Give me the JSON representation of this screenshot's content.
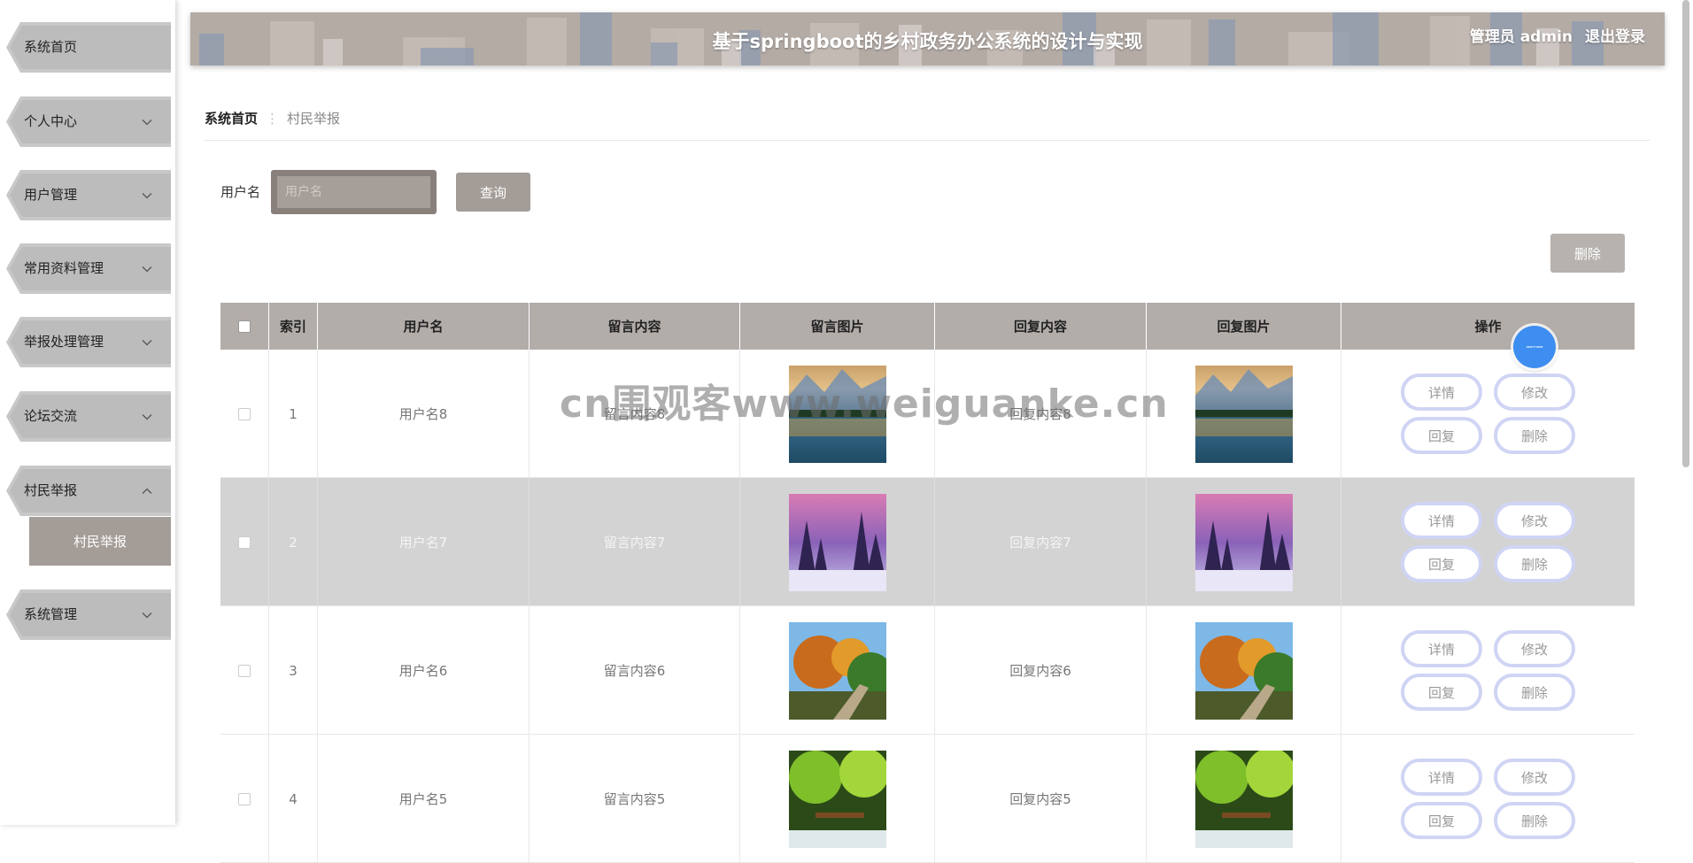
{
  "header": {
    "title": "基于springboot的乡村政务办公系统的设计与实现",
    "user_label": "管理员 admin",
    "logout_label": "退出登录"
  },
  "sidebar": {
    "items": [
      {
        "label": "系统首页"
      },
      {
        "label": "个人中心"
      },
      {
        "label": "用户管理"
      },
      {
        "label": "常用资料管理"
      },
      {
        "label": "举报处理管理"
      },
      {
        "label": "论坛交流"
      },
      {
        "label": "村民举报"
      },
      {
        "label": "系统管理"
      }
    ],
    "submenu_label": "村民举报"
  },
  "breadcrumb": {
    "home": "系统首页",
    "separator": "⋮",
    "current": "村民举报"
  },
  "search": {
    "label": "用户名",
    "placeholder": "用户名",
    "query_button": "查询"
  },
  "delete_button": "删除",
  "table": {
    "headers": [
      "索引",
      "用户名",
      "留言内容",
      "留言图片",
      "回复内容",
      "回复图片",
      "操作"
    ],
    "rows": [
      {
        "index": "1",
        "username": "用户名8",
        "message": "留言内容8",
        "reply": "回复内容8",
        "image": "lake-mountain"
      },
      {
        "index": "2",
        "username": "用户名7",
        "message": "留言内容7",
        "reply": "回复内容7",
        "image": "snow-forest"
      },
      {
        "index": "3",
        "username": "用户名6",
        "message": "留言内容6",
        "reply": "回复内容6",
        "image": "autumn-stairs"
      },
      {
        "index": "4",
        "username": "用户名5",
        "message": "留言内容5",
        "reply": "回复内容5",
        "image": "forest-bridge"
      }
    ],
    "actions": [
      "详情",
      "修改",
      "回复",
      "删除"
    ]
  },
  "watermark": "cn围观客www.weiguanke.cn",
  "colors": {
    "accent": "#a39c97",
    "header_bg": "#b4aba5",
    "table_header_bg": "#b3adaa",
    "row_alt_bg": "#d3d3d3",
    "action_border": "#d0d4f4"
  }
}
